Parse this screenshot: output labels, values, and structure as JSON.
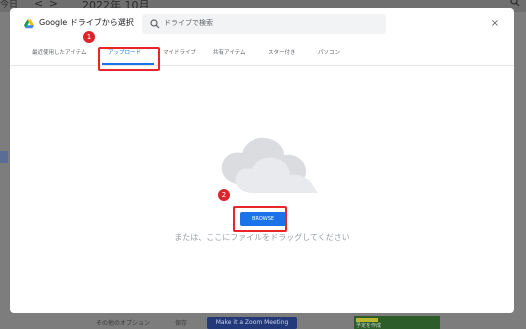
{
  "background": {
    "nav_arrows": "<  >",
    "date": "2022年 10月",
    "search_icon": "search-icon",
    "left_label": "今日",
    "bottom_label_1": "その他のオプション",
    "bottom_label_2": "保存",
    "bottom_button": "Make it a Zoom Meeting",
    "bottom_side_label": "予定を作成"
  },
  "dialog": {
    "title": "Google ドライブから選択",
    "search_placeholder": "ドライブで検索",
    "close_label": "×",
    "tabs": [
      {
        "label": "最近使用したアイテム"
      },
      {
        "label": "アップロード"
      },
      {
        "label": "マイドライブ"
      },
      {
        "label": "共有アイテム"
      },
      {
        "label": "スター付き"
      },
      {
        "label": "パソコン"
      }
    ],
    "active_tab_index": 1,
    "browse_label": "BROWSE",
    "drag_text": "または、ここにファイルをドラッグしてください"
  },
  "callouts": [
    {
      "number": "1",
      "target": "upload tab"
    },
    {
      "number": "2",
      "target": "browse button"
    }
  ],
  "colors": {
    "accent": "#1a73e8",
    "callout": "#e8262a",
    "overlay": "#7d7d7d"
  }
}
